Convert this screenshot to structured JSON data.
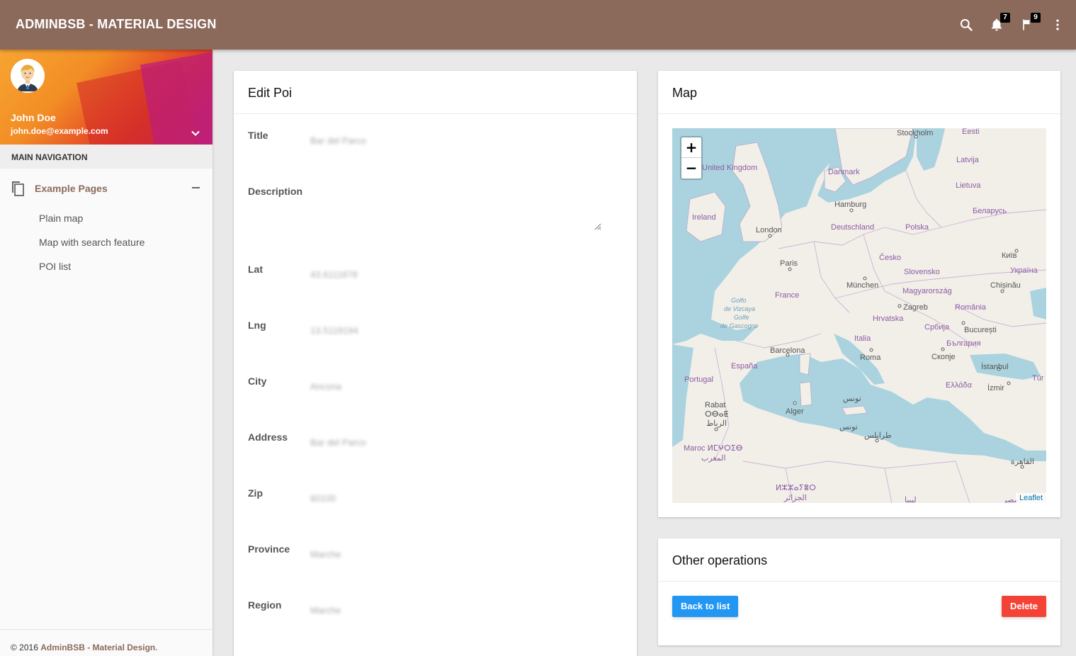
{
  "app": {
    "brand": "ADMINBSB - MATERIAL DESIGN"
  },
  "topbar": {
    "icons": [
      {
        "name": "search-icon"
      },
      {
        "name": "notifications-icon",
        "badge": "7"
      },
      {
        "name": "flag-icon",
        "badge": "9"
      },
      {
        "name": "more-vert-icon"
      }
    ]
  },
  "user": {
    "name": "John Doe",
    "email": "john.doe@example.com"
  },
  "sidebar": {
    "header": "MAIN NAVIGATION",
    "group": {
      "label": "Example Pages",
      "items": [
        {
          "label": "Plain map"
        },
        {
          "label": "Map with search feature"
        },
        {
          "label": "POI list"
        }
      ]
    }
  },
  "footer": {
    "prefix": "© 2016 ",
    "brand": "AdminBSB - Material Design",
    "suffix": "."
  },
  "edit_card": {
    "title": "Edit Poi",
    "fields": [
      {
        "label": "Title",
        "value": "Bar del Parco"
      },
      {
        "label": "Description",
        "value": ""
      },
      {
        "label": "Lat",
        "value": "43.6111878"
      },
      {
        "label": "Lng",
        "value": "13.5119194"
      },
      {
        "label": "City",
        "value": "Ancona"
      },
      {
        "label": "Address",
        "value": "Bar del Parco"
      },
      {
        "label": "Zip",
        "value": "60100"
      },
      {
        "label": "Province",
        "value": "Marche"
      },
      {
        "label": "Region",
        "value": "Marche"
      }
    ]
  },
  "map_card": {
    "title": "Map",
    "zoom_in": "+",
    "zoom_out": "−",
    "attribution": "Leaflet",
    "labels": {
      "stockholm": "Stockholm",
      "eesti": "Eesti",
      "latvija": "Latvija",
      "lietuva": "Lietuva",
      "uk": "United Kingdom",
      "danmark": "Danmark",
      "ireland": "Ireland",
      "hamburg": "Hamburg",
      "belarus": "Беларусь",
      "london": "London",
      "deutschland": "Deutschland",
      "polska": "Polska",
      "kyiv": "Київ",
      "cesko": "Česko",
      "ukraina": "Україна",
      "paris": "Paris",
      "slovensko": "Slovensko",
      "munchen": "München",
      "chisinau": "Chișinău",
      "magyar": "Magyarország",
      "france": "France",
      "golfo1": "Golfo",
      "golfo2": "de Vizcaya",
      "golfe1": "Golfe",
      "golfe2": "de Gascogne",
      "zagreb": "Zagreb",
      "romania": "România",
      "hrvatska": "Hrvatska",
      "srbija": "Србија",
      "bucuresti": "București",
      "italia": "Italia",
      "bulgaria": "България",
      "barcelona": "Barcelona",
      "roma": "Roma",
      "skopje": "Скопје",
      "espana": "España",
      "istanbul": "İstanbul",
      "turk": "Tür",
      "portugal": "Portugal",
      "ellada": "Ελλάδα",
      "izmir": "İzmir",
      "tunis1": "تونس",
      "rabat": "Rabat",
      "rabat2": "ⵔⴱⴰⵟ",
      "rabat3": "الرباط",
      "alger": "Alger",
      "tunis2": "تونس",
      "tripoli": "طرابلس",
      "maroc1": "Maroc ⵍⵎⵖⵔⵉⴱ",
      "maroc2": "المغرب",
      "cairo": "القاهرة",
      "dz1": "ⵍⵣⵣⴰⵢⴻⵔ",
      "dz2": "الجزائر",
      "libya": "ليبيا",
      "misr": "مصر"
    }
  },
  "ops_card": {
    "title": "Other operations",
    "back_label": "Back to list",
    "delete_label": "Delete"
  },
  "colors": {
    "topbar": "#8b6a5b",
    "accent": "#8b6a5b",
    "back_button": "#2196f3",
    "delete_button": "#f44336"
  }
}
